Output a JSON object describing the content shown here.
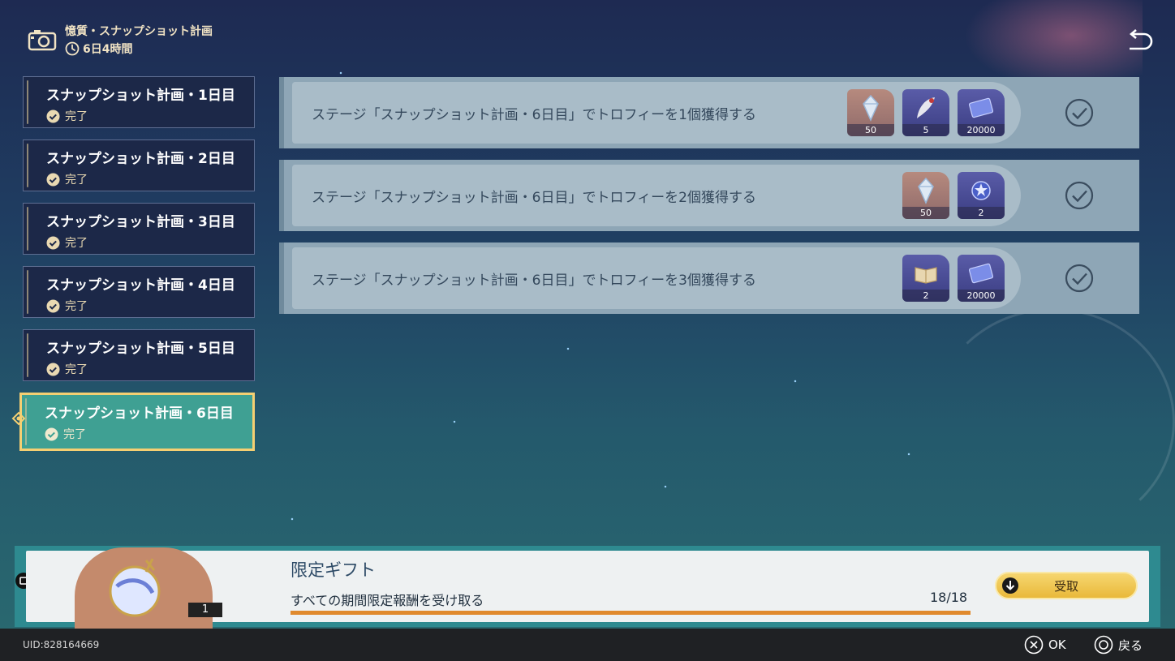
{
  "header": {
    "title": "憶質・スナップショット計画",
    "timer": "6日4時間"
  },
  "sidebar": {
    "items": [
      {
        "label": "スナップショット計画・1日目",
        "status": "完了"
      },
      {
        "label": "スナップショット計画・2日目",
        "status": "完了"
      },
      {
        "label": "スナップショット計画・3日目",
        "status": "完了"
      },
      {
        "label": "スナップショット計画・4日目",
        "status": "完了"
      },
      {
        "label": "スナップショット計画・5日目",
        "status": "完了"
      },
      {
        "label": "スナップショット計画・6日目",
        "status": "完了"
      }
    ],
    "active_index": 5
  },
  "quests": [
    {
      "text": "ステージ「スナップショット計画・6日目」でトロフィーを1個獲得する",
      "rewards": [
        {
          "icon": "crystal-icon",
          "qty": "50",
          "rarity": "orange"
        },
        {
          "icon": "feather-icon",
          "qty": "5",
          "rarity": "purple"
        },
        {
          "icon": "credit-card-icon",
          "qty": "20000",
          "rarity": "purple"
        }
      ],
      "completed": true
    },
    {
      "text": "ステージ「スナップショット計画・6日目」でトロフィーを2個獲得する",
      "rewards": [
        {
          "icon": "crystal-icon",
          "qty": "50",
          "rarity": "orange"
        },
        {
          "icon": "star-orb-icon",
          "qty": "2",
          "rarity": "purple"
        }
      ],
      "completed": true
    },
    {
      "text": "ステージ「スナップショット計画・6日目」でトロフィーを3個獲得する",
      "rewards": [
        {
          "icon": "book-icon",
          "qty": "2",
          "rarity": "purple"
        },
        {
          "icon": "credit-card-icon",
          "qty": "20000",
          "rarity": "purple"
        }
      ],
      "completed": true
    }
  ],
  "gift": {
    "title": "限定ギフト",
    "count": "1",
    "description": "すべての期間限定報酬を受け取る",
    "progress": "18/18",
    "progress_fraction": 1.0,
    "claim_label": "受取"
  },
  "footer": {
    "uid": "UID:828164669",
    "ok_label": "OK",
    "back_label": "戻る"
  },
  "colors": {
    "accent_gold": "#f5cf72",
    "active_teal": "#3fa093",
    "progress_orange": "#e08a2e"
  }
}
